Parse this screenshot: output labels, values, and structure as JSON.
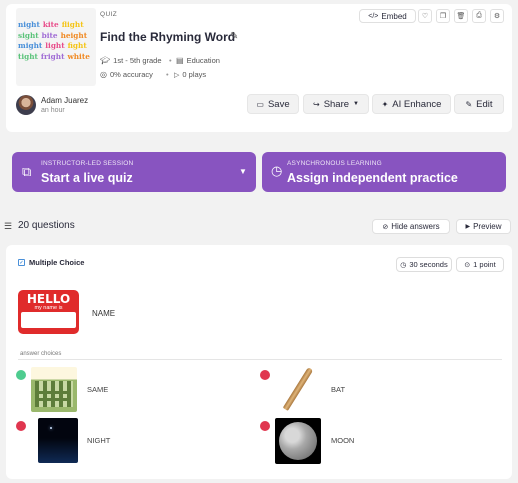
{
  "quiz": {
    "type_label": "QUIZ",
    "title": "Find the Rhyming Word",
    "grade": "1st - 5th grade",
    "subject": "Education",
    "accuracy": "0% accuracy",
    "plays": "0 plays",
    "thumbnail_rows": [
      [
        "night",
        "kite",
        "flight"
      ],
      [
        "sight",
        "bite",
        "height"
      ],
      [
        "might",
        "light",
        "fight"
      ],
      [
        "tight",
        "fright",
        "white"
      ]
    ]
  },
  "author": {
    "name": "Adam Juarez",
    "time": "an hour"
  },
  "actions": {
    "embed": "Embed",
    "save": "Save",
    "share": "Share",
    "ai_enhance": "AI Enhance",
    "edit": "Edit"
  },
  "session": {
    "live_small": "INSTRUCTOR-LED SESSION",
    "live_big": "Start a live quiz",
    "async_small": "ASYNCHRONOUS LEARNING",
    "async_big": "Assign independent practice"
  },
  "questions": {
    "count_label": "20 questions",
    "hide_answers": "Hide answers",
    "preview": "Preview"
  },
  "question": {
    "type": "Multiple Choice",
    "time": "30 seconds",
    "points": "1 point",
    "prompt_word": "NAME",
    "hello_title": "HELLO",
    "hello_sub": "my name is",
    "answer_choices_label": "answer choices",
    "choices": [
      {
        "label": "SAME",
        "correct": true
      },
      {
        "label": "BAT",
        "correct": false
      },
      {
        "label": "NIGHT",
        "correct": false
      },
      {
        "label": "MOON",
        "correct": false
      }
    ]
  },
  "colors": {
    "purple": "#8854c0",
    "correct": "#4ecc8f",
    "incorrect": "#e0364f"
  }
}
